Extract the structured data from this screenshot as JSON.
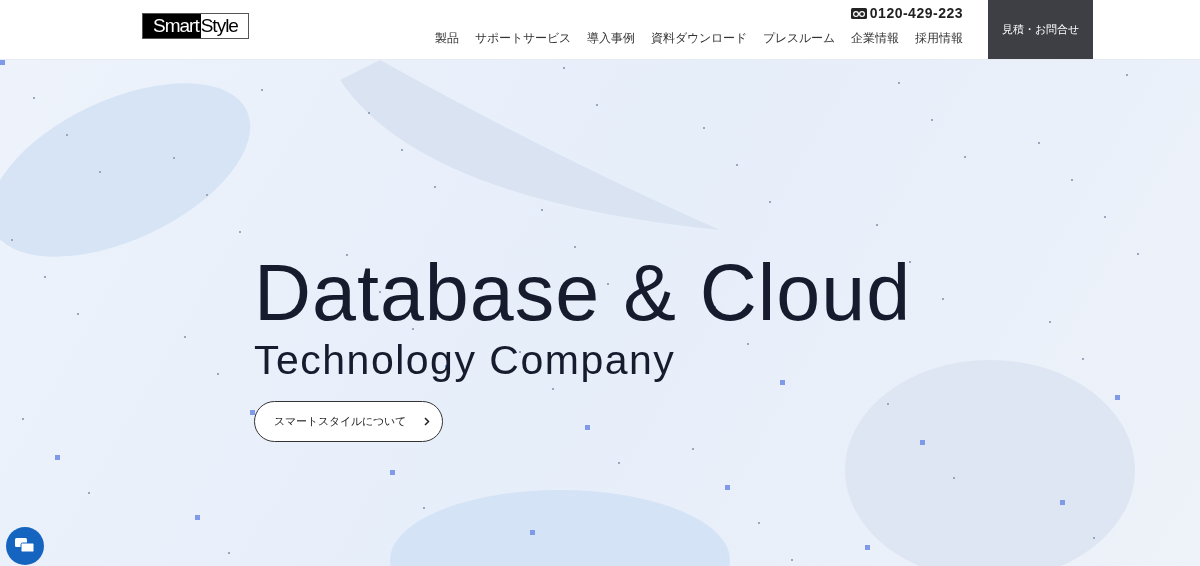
{
  "header": {
    "logo": {
      "part_1": "Smart",
      "part_2": "Style"
    },
    "phone": "0120-429-223",
    "nav": [
      "製品",
      "サポートサービス",
      "導入事例",
      "資料ダウンロード",
      "プレスルーム",
      "企業情報",
      "採用情報"
    ],
    "contact_button": "見積・お問合せ"
  },
  "hero": {
    "title": "Database & Cloud",
    "subtitle": "Technology Company",
    "button": "スマートスタイルについて"
  }
}
